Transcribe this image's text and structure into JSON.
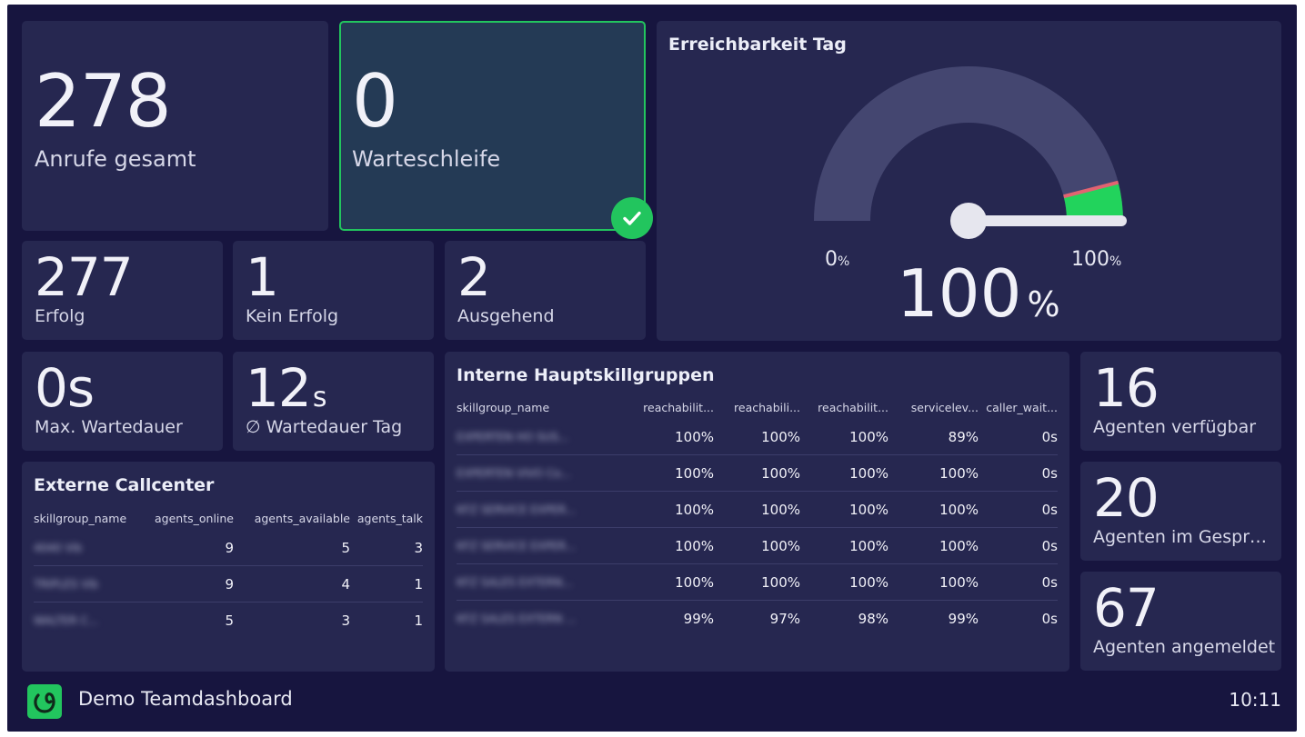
{
  "kpis": {
    "calls_total": {
      "value": "278",
      "label": "Anrufe gesamt"
    },
    "queue": {
      "value": "0",
      "label": "Warteschleife"
    },
    "success": {
      "value": "277",
      "label": "Erfolg"
    },
    "no_success": {
      "value": "1",
      "label": "Kein Erfolg"
    },
    "outgoing": {
      "value": "2",
      "label": "Ausgehend"
    },
    "max_wait": {
      "value": "0s",
      "label": "Max. Wartedauer"
    },
    "avg_wait": {
      "value": "12",
      "unit": "s",
      "label": "∅ Wartedauer Tag"
    },
    "agents_available": {
      "value": "16",
      "label": "Agenten verfügbar"
    },
    "agents_in_call": {
      "value": "20",
      "label": "Agenten im Gesprä..."
    },
    "agents_logged_in": {
      "value": "67",
      "label": "Agenten angemeldet"
    }
  },
  "gauge": {
    "title": "Erreichbarkeit Tag",
    "value": 100,
    "value_text": "100",
    "unit": "%",
    "min_text": "0",
    "max_text": "100",
    "track_color": "#444670",
    "fill_color": "#22d35c",
    "threshold_color": "#e26371"
  },
  "external_callcenter": {
    "title": "Externe Callcenter",
    "columns": [
      "skillgroup_name",
      "agents_online",
      "agents_available",
      "agents_talk"
    ],
    "rows": [
      [
        "4040 Vib",
        "9",
        "5",
        "3"
      ],
      [
        "TRIPLES Vib",
        "9",
        "4",
        "1"
      ],
      [
        "WALTER C...",
        "5",
        "3",
        "1"
      ]
    ]
  },
  "internal_skillgroups": {
    "title": "Interne Hauptskillgruppen",
    "columns": [
      "skillgroup_name",
      "reachabilit...",
      "reachabili...",
      "reachabilit...",
      "servicelev...",
      "caller_wait..."
    ],
    "rows": [
      [
        "EXPERTEN HO SUS...",
        "100%",
        "100%",
        "100%",
        "89%",
        "0s"
      ],
      [
        "EXPERTEN VIVO Co...",
        "100%",
        "100%",
        "100%",
        "100%",
        "0s"
      ],
      [
        "KFZ SERVICE EXPER...",
        "100%",
        "100%",
        "100%",
        "100%",
        "0s"
      ],
      [
        "KFZ SERVICE EXPER...",
        "100%",
        "100%",
        "100%",
        "100%",
        "0s"
      ],
      [
        "KFZ SALES EXTERN...",
        "100%",
        "100%",
        "100%",
        "100%",
        "0s"
      ],
      [
        "KFZ SALES EXTERN ...",
        "99%",
        "97%",
        "98%",
        "99%",
        "0s"
      ]
    ]
  },
  "footer": {
    "title": "Demo Teamdashboard",
    "time": "10:11",
    "logo_icon": "swirl-logo-icon",
    "brand_color": "#22c55e"
  },
  "status": {
    "queue_ok_icon": "check-icon"
  }
}
